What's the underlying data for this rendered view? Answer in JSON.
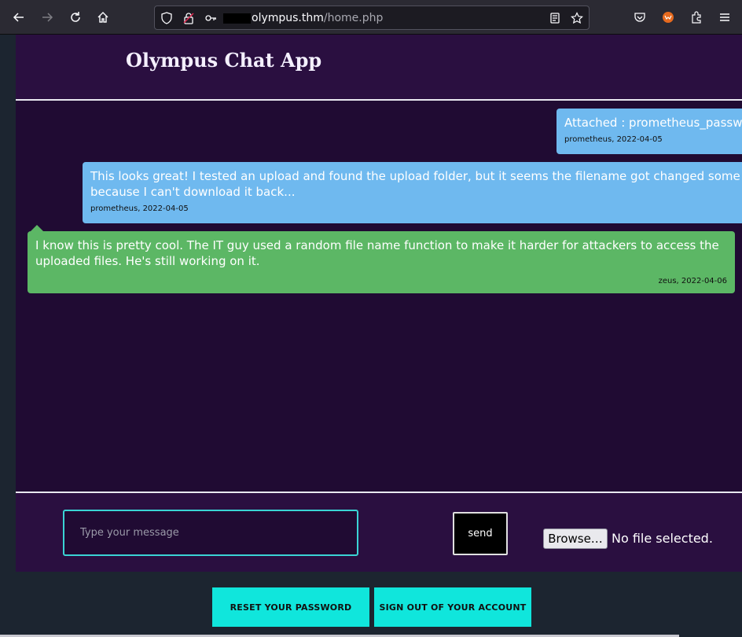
{
  "browser": {
    "url_domain": "olympus.thm",
    "url_path": "/home.php"
  },
  "app": {
    "title": "Olympus Chat App"
  },
  "messages": [
    {
      "text": "Attached : prometheus_passw",
      "author_date": "prometheus, 2022-04-05"
    },
    {
      "text": "This looks great! I tested an upload and found the upload folder, but it seems the filename got changed some\nbecause I can't download it back...",
      "author_date": "prometheus, 2022-04-05"
    },
    {
      "text": "I know this is pretty cool. The IT guy used a random file name function to make it harder for attackers to access the\nuploaded files. He's still working on it.",
      "author_date": "zeus, 2022-04-06"
    }
  ],
  "composer": {
    "placeholder": "Type your message",
    "send_label": "send",
    "browse_label": "Browse…",
    "file_status": "No file selected."
  },
  "actions": {
    "reset_label": "RESET YOUR PASSWORD",
    "signout_label": "SIGN OUT OF YOUR ACCOUNT"
  }
}
